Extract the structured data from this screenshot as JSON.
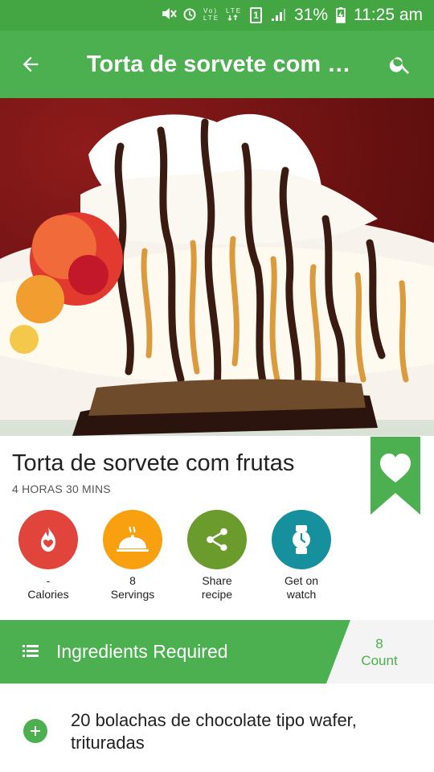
{
  "status": {
    "battery": "31%",
    "time": "11:25 am",
    "sim": "1",
    "network": "LTE",
    "icons": [
      "mute-icon",
      "alarm-icon",
      "volte-icon",
      "lte-icon",
      "signal-icon",
      "battery-charging-icon"
    ]
  },
  "appbar": {
    "title": "Torta de sorvete com fr…"
  },
  "recipe": {
    "title": "Torta de sorvete com frutas",
    "time": "4 HORAS 30 MINS"
  },
  "actions": [
    {
      "value": "-",
      "label": "Calories",
      "icon": "calories-icon",
      "color": "#e0443a"
    },
    {
      "value": "8",
      "label": "Servings",
      "icon": "serving-dish-icon",
      "color": "#f9a011"
    },
    {
      "value": "",
      "label": "Share\nrecipe",
      "icon": "share-icon",
      "color": "#6a9b2c"
    },
    {
      "value": "",
      "label": "Get on\nwatch",
      "icon": "watch-icon",
      "color": "#16909d"
    }
  ],
  "ingredients": {
    "header": "Ingredients Required",
    "count_value": "8",
    "count_label": "Count",
    "items": [
      "20 bolachas de chocolate tipo wafer, trituradas"
    ]
  },
  "colors": {
    "primary": "#4caf50",
    "status_bar": "#44a543",
    "header_grey": "#f4f4f4"
  }
}
